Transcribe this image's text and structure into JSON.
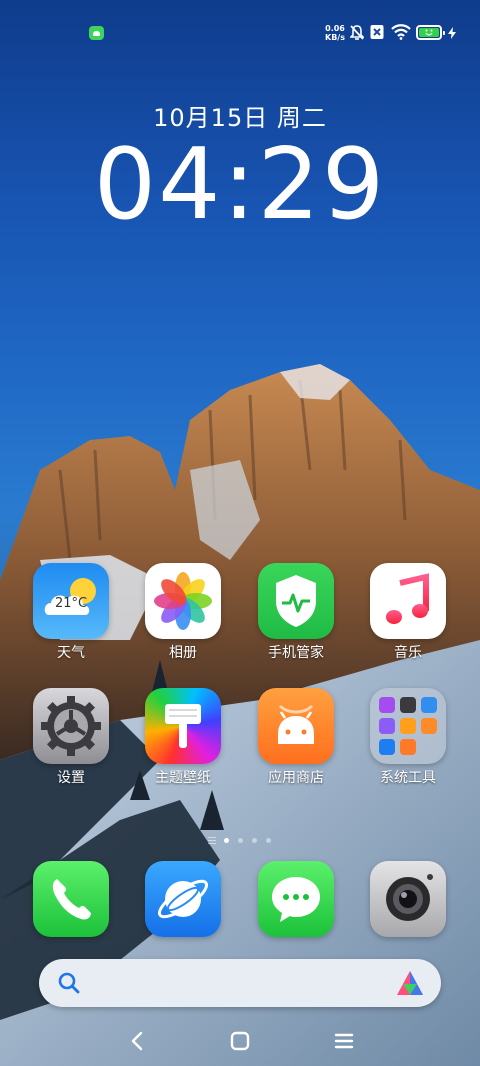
{
  "status_bar": {
    "notification_icon": "android-notification-icon",
    "net_speed_value": "0.06",
    "net_speed_unit": "KB/s",
    "icons": [
      "notifications-muted-icon",
      "sim-disabled-icon",
      "wifi-icon",
      "battery-charging-icon"
    ],
    "battery_level": 1.0,
    "battery_color": "#36d04a"
  },
  "clock": {
    "date": "10月15日 周二",
    "time": "04:29"
  },
  "apps": {
    "weather": {
      "label": "天气",
      "temperature": "21°C"
    },
    "photos": {
      "label": "相册"
    },
    "security": {
      "label": "手机管家"
    },
    "music": {
      "label": "音乐"
    },
    "settings": {
      "label": "设置"
    },
    "themes": {
      "label": "主题壁纸"
    },
    "app_store": {
      "label": "应用商店"
    },
    "system_tools": {
      "label": "系统工具"
    }
  },
  "dock": {
    "phone": "phone-icon",
    "browser": "browser-icon",
    "messages": "messages-icon",
    "camera": "camera-icon"
  },
  "page_indicator": {
    "pages": 4,
    "current": 1
  },
  "search": {
    "icon": "search-icon",
    "assistant_icon": "ai-assistant-icon"
  },
  "nav": [
    "back-icon",
    "home-icon",
    "recents-icon"
  ],
  "colors": {
    "accent_green": "#1fbb45",
    "sky_blue": "#1f68c4"
  }
}
